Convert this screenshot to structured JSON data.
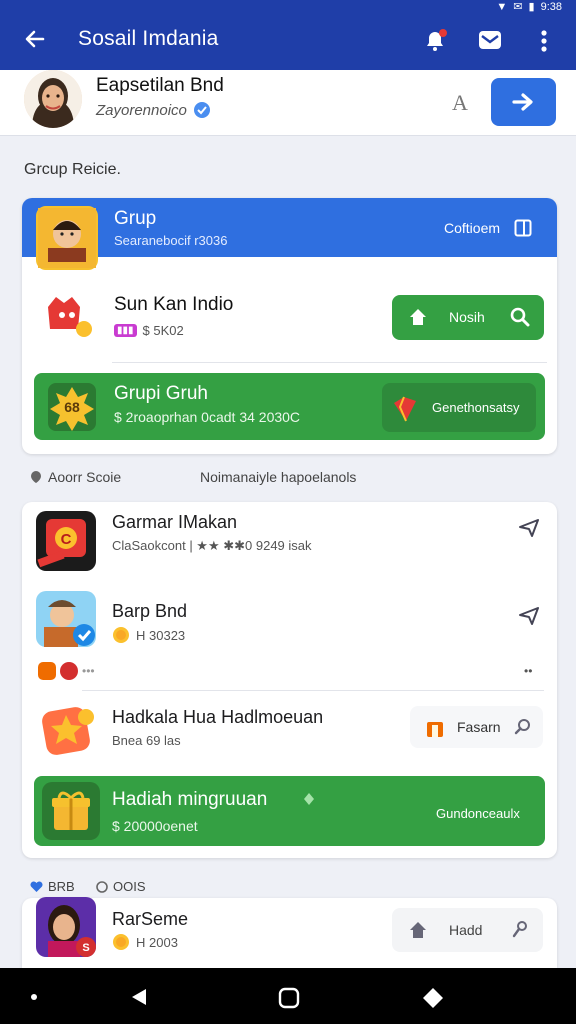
{
  "status": {
    "time": "9:38"
  },
  "header": {
    "title": "Sosail Imdania"
  },
  "profile": {
    "name": "Eapsetilan Bnd",
    "sub": "Zayorennoico",
    "font_btn": "A"
  },
  "section1": {
    "label": "Grcup Reicie."
  },
  "group_card": {
    "header": {
      "title": "Grup",
      "sub": "Searanebocif r3036",
      "action": "Coftioem"
    },
    "row1": {
      "title": "Sun Kan Indio",
      "badge": "▮▮▮",
      "price": "$ 5K02",
      "btn": "Nosih"
    },
    "row2": {
      "title": "Grupi Gruh",
      "price": "$ 2roaoprhan 0cadt 34 2030C",
      "btn": "Genethonsatsy"
    }
  },
  "section2": {
    "left": "Aoorr Scoie",
    "right": "Noimanaiyle hapoelanols"
  },
  "list_card": {
    "item1": {
      "title": "Garmar IMakan",
      "meta": "ClaSaokcont | ★★ ✱✱0 9249 isak"
    },
    "item2": {
      "title": "Barp Bnd",
      "meta": "H 30323"
    },
    "item3": {
      "title": "Hadkala Hua Hadlmoeuan",
      "meta": "Bnea 69 las",
      "btn": "Fasarn"
    },
    "item4": {
      "title": "Hadiah mingruuan",
      "price": "$ 20000oenet",
      "btn": "Gundonceaulx"
    }
  },
  "section3": {
    "left": "BRB",
    "right": "OOIS"
  },
  "bottom_card": {
    "title": "RarSeme",
    "meta": "H 2003",
    "btn": "Hadd"
  },
  "colors": {
    "primary": "#1f3ea8",
    "accent_blue": "#2f6fe0",
    "green": "#34a043"
  }
}
